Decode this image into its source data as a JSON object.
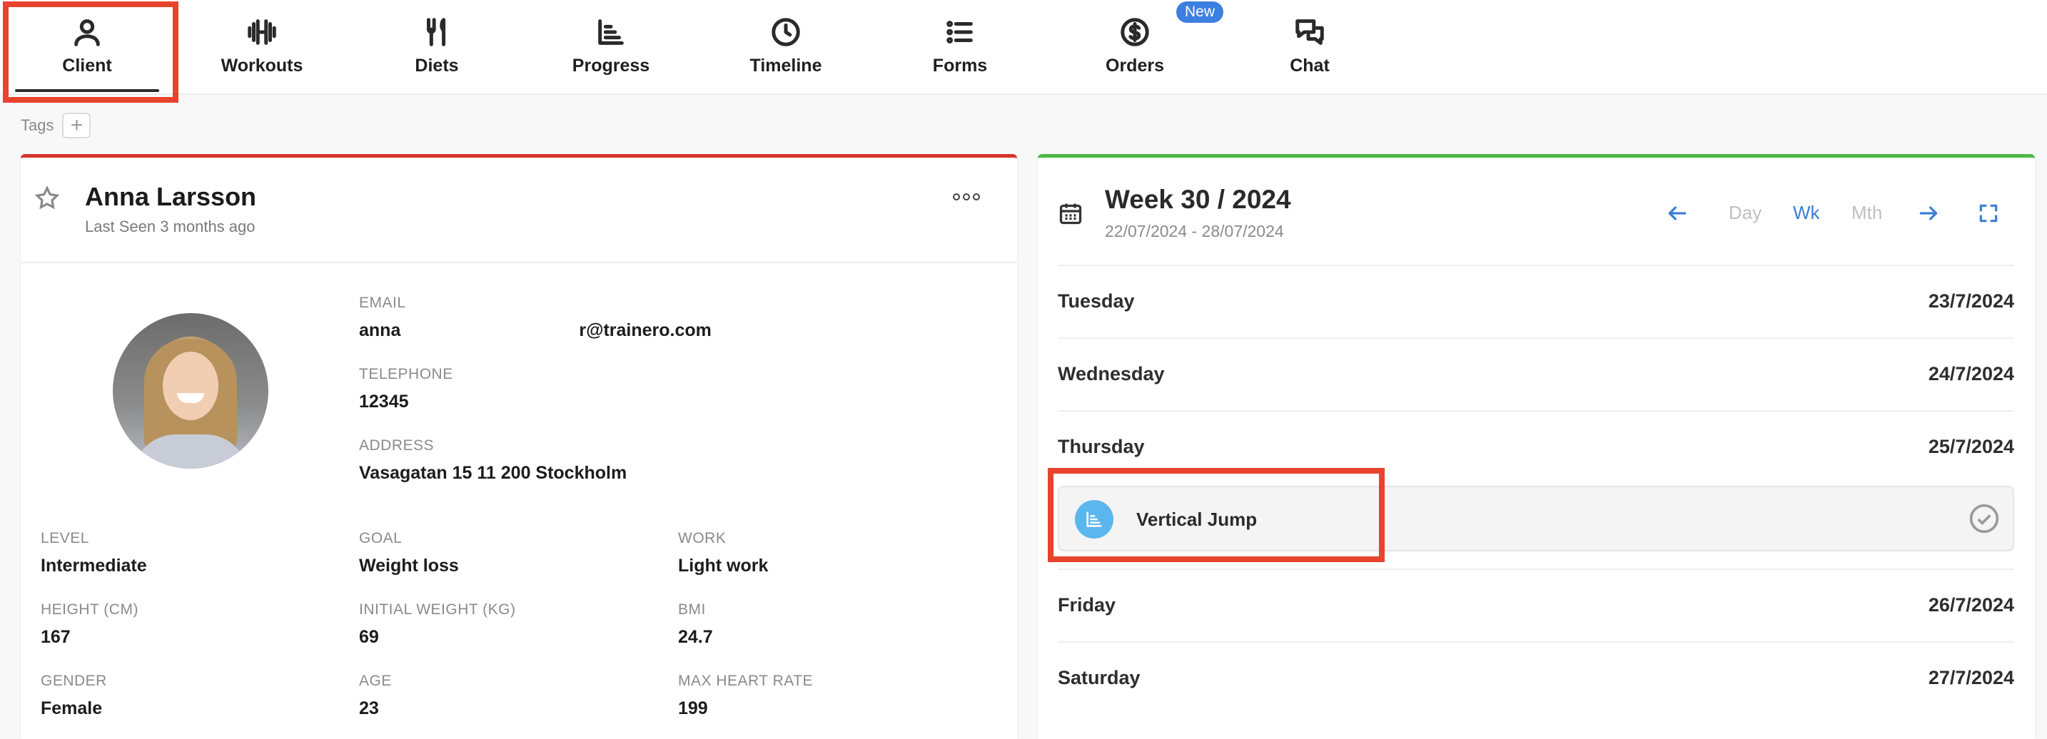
{
  "nav": {
    "items": [
      {
        "label": "Client",
        "icon": "user-icon"
      },
      {
        "label": "Workouts",
        "icon": "dumbbell-icon"
      },
      {
        "label": "Diets",
        "icon": "utensils-icon"
      },
      {
        "label": "Progress",
        "icon": "chart-icon"
      },
      {
        "label": "Timeline",
        "icon": "clock-icon"
      },
      {
        "label": "Forms",
        "icon": "list-icon"
      },
      {
        "label": "Orders",
        "icon": "dollar-icon"
      },
      {
        "label": "Chat",
        "icon": "chat-icon"
      }
    ],
    "orders_badge": "New",
    "active": "Client"
  },
  "tags": {
    "label": "Tags",
    "add": "+"
  },
  "client": {
    "name": "Anna Larsson",
    "last_seen": "Last Seen 3 months ago",
    "email_label": "EMAIL",
    "email_start": "anna",
    "email_end": "r@trainero.com",
    "telephone_label": "TELEPHONE",
    "telephone": "12345",
    "address_label": "ADDRESS",
    "address": "Vasagatan 15 11 200 Stockholm",
    "level_label": "LEVEL",
    "level": "Intermediate",
    "goal_label": "GOAL",
    "goal": "Weight loss",
    "work_label": "WORK",
    "work": "Light work",
    "height_label": "HEIGHT (CM)",
    "height": "167",
    "initial_weight_label": "INITIAL WEIGHT (KG)",
    "initial_weight": "69",
    "bmi_label": "BMI",
    "bmi": "24.7",
    "gender_label": "GENDER",
    "gender": "Female",
    "age_label": "AGE",
    "age": "23",
    "max_hr_label": "MAX HEART RATE",
    "max_hr": "199"
  },
  "calendar": {
    "title": "Week 30 / 2024",
    "range": "22/07/2024 - 28/07/2024",
    "view_day": "Day",
    "view_week": "Wk",
    "view_month": "Mth",
    "days": [
      {
        "name": "Tuesday",
        "date": "23/7/2024"
      },
      {
        "name": "Wednesday",
        "date": "24/7/2024"
      },
      {
        "name": "Thursday",
        "date": "25/7/2024"
      },
      {
        "name": "Friday",
        "date": "26/7/2024"
      },
      {
        "name": "Saturday",
        "date": "27/7/2024"
      }
    ],
    "event": {
      "title": "Vertical Jump",
      "icon": "chart-icon"
    }
  },
  "colors": {
    "highlight": "#e8432b",
    "left_card_accent": "#d6342a",
    "right_card_accent": "#4cb748",
    "link_blue": "#3b7ed8",
    "badge_blue": "#3d7fe0"
  }
}
